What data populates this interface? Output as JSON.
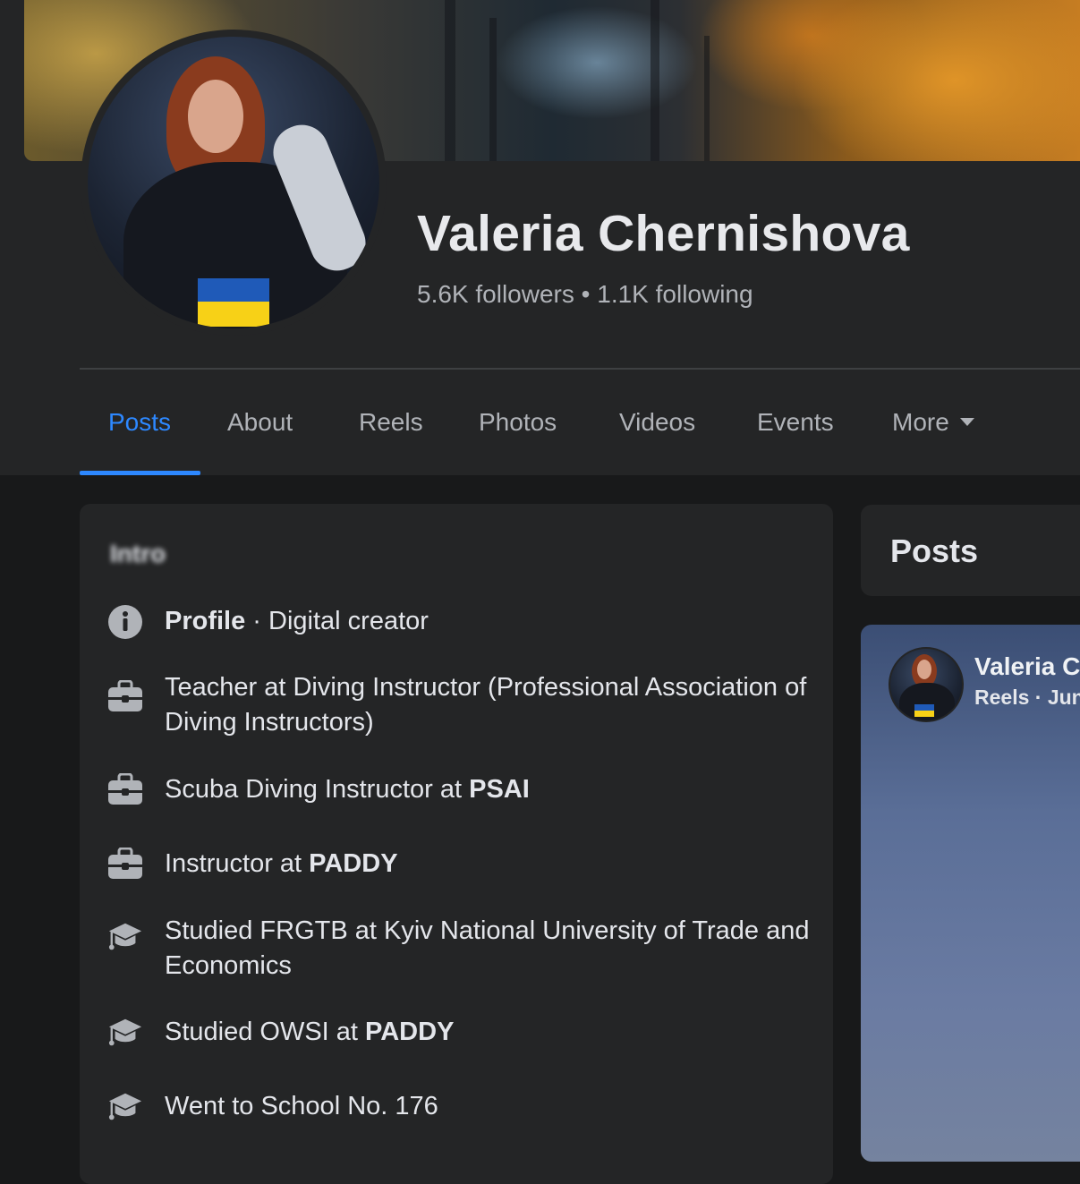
{
  "profile": {
    "name": "Valeria Chernishova",
    "followers": "5.6K followers",
    "separator": " • ",
    "following": "1.1K following"
  },
  "tabs": [
    {
      "label": "Posts",
      "active": true
    },
    {
      "label": "About"
    },
    {
      "label": "Reels"
    },
    {
      "label": "Photos"
    },
    {
      "label": "Videos"
    },
    {
      "label": "Events"
    },
    {
      "label": "More"
    }
  ],
  "intro": {
    "heading": "Intro",
    "items": [
      {
        "icon": "info-icon",
        "bold_prefix": "Profile",
        "text": " · Digital creator"
      },
      {
        "icon": "briefcase-icon",
        "text": "Teacher at Diving Instructor (Professional Association of Diving Instructors)"
      },
      {
        "icon": "briefcase-icon",
        "text": "Scuba Diving Instructor at ",
        "bold_suffix": "PSAI"
      },
      {
        "icon": "briefcase-icon",
        "text": "Instructor at ",
        "bold_suffix": "PADDY"
      },
      {
        "icon": "graduation-cap-icon",
        "text": "Studied FRGTB at Kyiv National University of Trade and Economics"
      },
      {
        "icon": "graduation-cap-icon",
        "text": "Studied OWSI at ",
        "bold_suffix": "PADDY"
      },
      {
        "icon": "graduation-cap-icon",
        "text": "Went to School No. 176"
      }
    ]
  },
  "posts_panel": {
    "heading": "Posts",
    "post": {
      "author": "Valeria C",
      "meta": "Reels · Jun"
    }
  },
  "colors": {
    "accent": "#2d88ff",
    "background": "#18191a",
    "card": "#242526",
    "flag_blue": "#1f5ab8",
    "flag_yellow": "#f7d117"
  }
}
